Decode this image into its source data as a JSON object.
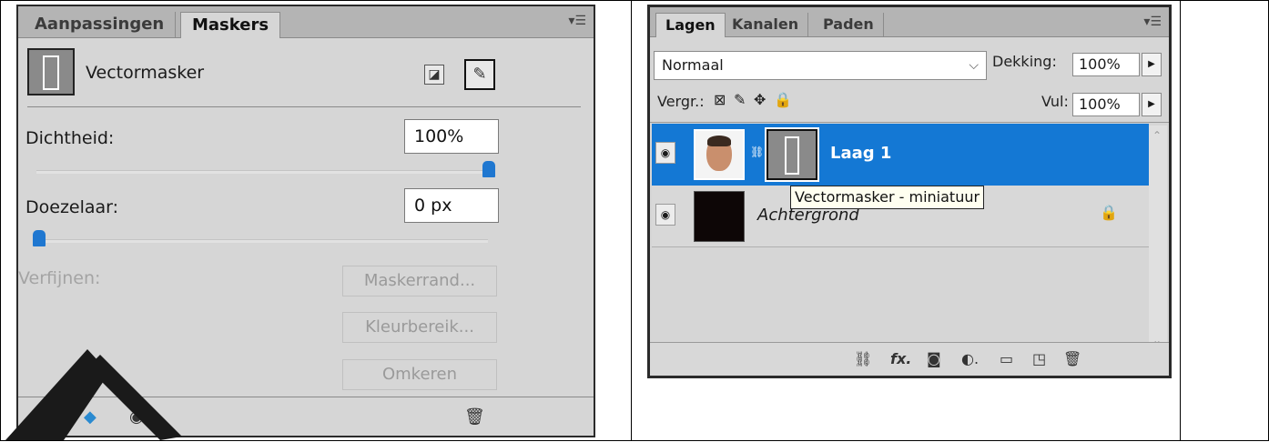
{
  "masks_panel": {
    "tabs": [
      "Aanpassingen",
      "Maskers"
    ],
    "active_tab": "Maskers",
    "mask_type": "Vectormasker",
    "density": {
      "label": "Dichtheid:",
      "value": "100%",
      "slider_fraction": 1.0
    },
    "feather": {
      "label": "Doezelaar:",
      "value": "0 px",
      "slider_fraction": 0.0
    },
    "refine": {
      "label": "Verfijnen:",
      "buttons": [
        "Maskerrand...",
        "Kleurbereik...",
        "Omkeren"
      ]
    },
    "icons": [
      "add-pixel-mask-icon",
      "add-vector-mask-icon",
      "load-selection-icon",
      "apply-mask-icon",
      "visibility-icon",
      "trash-icon",
      "panel-menu-icon"
    ]
  },
  "layers_panel": {
    "tabs": [
      "Lagen",
      "Kanalen",
      "Paden"
    ],
    "active_tab": "Lagen",
    "blend_mode": "Normaal",
    "opacity": {
      "label": "Dekking:",
      "value": "100%"
    },
    "lock": {
      "label": "Vergr.:"
    },
    "fill": {
      "label": "Vul:",
      "value": "100%"
    },
    "layers": [
      {
        "name": "Laag 1",
        "selected": true,
        "has_vector_mask": true
      },
      {
        "name": "Achtergrond",
        "selected": false,
        "locked": true
      }
    ],
    "tooltip": "Vectormasker - miniatuur",
    "selection_color": "#1478d4",
    "footer_icons": [
      "link-icon",
      "fx-icon",
      "mask-icon",
      "adjustment-icon",
      "folder-icon",
      "new-layer-icon",
      "trash-icon"
    ]
  }
}
